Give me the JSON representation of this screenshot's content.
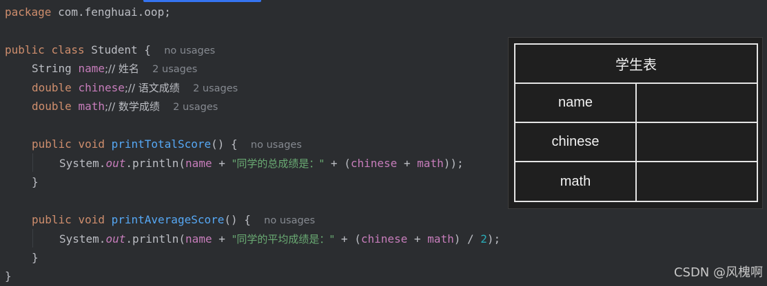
{
  "code": {
    "package_kw": "package",
    "package_name": " com.fenghuai.oop;",
    "class_decl": {
      "public": "public",
      "class": "class",
      "name": " Student {",
      "hint": "no usages"
    },
    "fields": [
      {
        "type": "String",
        "name": "name",
        "comment": ";// 姓名",
        "hint": "2 usages"
      },
      {
        "type": "double",
        "name": "chinese",
        "comment": ";// 语文成绩",
        "hint": "2 usages"
      },
      {
        "type": "double",
        "name": "math",
        "comment": ";// 数学成绩",
        "hint": "2 usages"
      }
    ],
    "method1": {
      "public": "public",
      "void": "void",
      "name": "printTotalScore",
      "parens": "() {",
      "hint": "no usages",
      "body_system": "System.",
      "body_out": "out",
      "body_println": ".println(",
      "arg_name": "name",
      "plus1": " + ",
      "str": "\"同学的总成绩是：\"",
      "plus2": " + (",
      "arg_chinese": "chinese",
      "plus3": " + ",
      "arg_math": "math",
      "tail": "));",
      "close": "}"
    },
    "method2": {
      "public": "public",
      "void": "void",
      "name": "printAverageScore",
      "parens": "() {",
      "hint": "no usages",
      "body_system": "System.",
      "body_out": "out",
      "body_println": ".println(",
      "arg_name": "name",
      "plus1": " + ",
      "str": "\"同学的平均成绩是：\"",
      "plus2": " + (",
      "arg_chinese": "chinese",
      "plus3": " + ",
      "arg_math": "math",
      "div": ") / ",
      "num": "2",
      "tail": ");",
      "close": "}"
    },
    "class_close": "}"
  },
  "table": {
    "title": "学生表",
    "rows": [
      {
        "label": "name",
        "value": ""
      },
      {
        "label": "chinese",
        "value": ""
      },
      {
        "label": "math",
        "value": ""
      }
    ]
  },
  "watermark": "CSDN @风槐啊",
  "colors": {
    "background": "#2b2d30",
    "keyword": "#cf8e6d",
    "field": "#c77dbb",
    "function": "#56a8f5",
    "string": "#6aab73",
    "number": "#2aacb8",
    "hint": "#868a91",
    "tab_accent": "#3574f0"
  }
}
